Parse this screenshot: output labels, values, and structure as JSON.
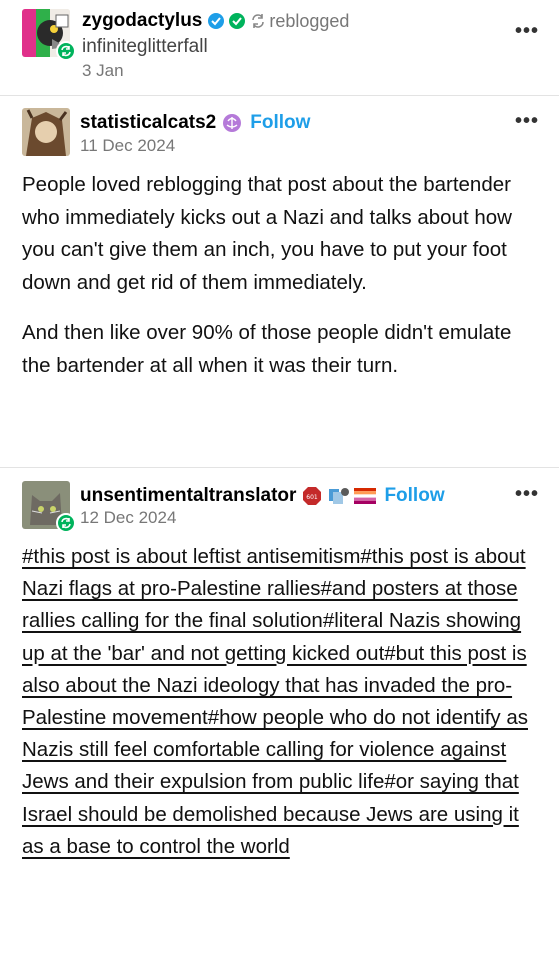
{
  "post_header": {
    "reblogger": "zygodactylus",
    "reblogged_label": "reblogged",
    "source": "infiniteglitterfall",
    "date": "3 Jan",
    "more_label": "•••"
  },
  "op": {
    "username": "statisticalcats2",
    "follow_label": "Follow",
    "date": "11 Dec 2024",
    "more_label": "•••",
    "paragraphs": [
      "People loved reblogging that post about the bartender who immediately kicks out a Nazi and talks about how you can't give them an inch, you have to put your foot down and get rid of them immediately.",
      "And then like over 90% of those people didn't emulate the bartender at all when it was their turn."
    ]
  },
  "reply": {
    "username": "unsentimentaltranslator",
    "follow_label": "Follow",
    "date": "12 Dec 2024",
    "more_label": "•••",
    "badge_text": "601",
    "tags_text": "#this post is about leftist antisemitism#this post is about Nazi flags at pro-Palestine rallies#and posters at those rallies calling for the final solution#literal Nazis showing up at the 'bar' and not getting kicked out#but this post is also about the Nazi ideology that has invaded the pro-Palestine movement#how people who do not identify as Nazis still feel comfortable calling for violence against Jews and their expulsion from public life#or saying that Israel should be demolished because Jews are using it as a base to control the world"
  },
  "colors": {
    "follow": "#1e9ee8",
    "reblog_green": "#00b35c",
    "verified_blue": "#1e9ee8"
  }
}
